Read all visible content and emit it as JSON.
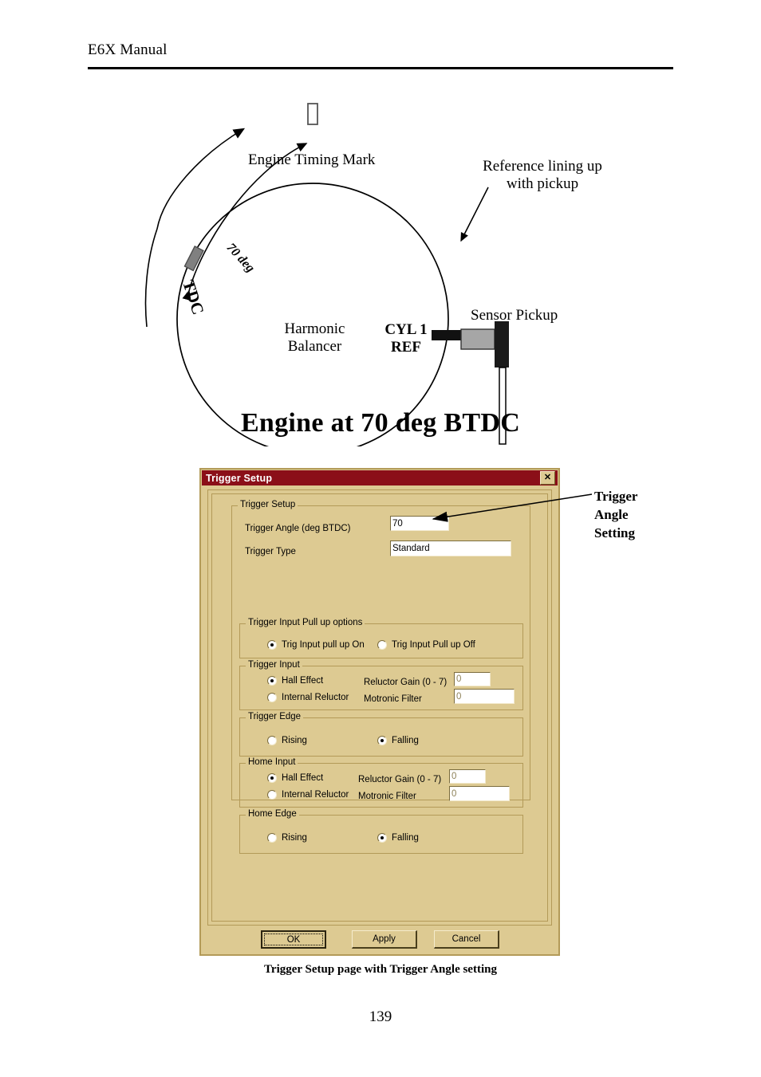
{
  "page": {
    "header": "E6X Manual",
    "folio": "139",
    "caption": "Trigger Setup page with Trigger Angle setting"
  },
  "diagram": {
    "heading": "Engine at 70 deg BTDC",
    "timing_mark_label": "Engine Timing Mark",
    "reference_label": "Reference lining up\nwith pickup",
    "sensor_label": "Sensor Pickup",
    "balancer_label": "Harmonic\nBalancer",
    "cyl1_ref_label": "CYL 1\nREF",
    "tdc_label": "TDC",
    "angle_label": "70 deg",
    "colors": {
      "tdc_mark": "#808080",
      "sensor_body": "#a6a6a6",
      "sensor_tip": "#1a1a1a",
      "outline": "#000000"
    }
  },
  "callout": {
    "label": "Trigger\nAngle\nSetting"
  },
  "dialog": {
    "title": "Trigger Setup",
    "close_label": "✕",
    "colors": {
      "titlebar": "#8b0f18",
      "face": "#ddca92",
      "border": "#b39a58"
    },
    "groups": {
      "trigger_setup": {
        "title": "Trigger Setup",
        "angle_label": "Trigger Angle (deg BTDC)",
        "angle_value": "70",
        "type_label": "Trigger Type",
        "type_value": "Standard"
      },
      "pullup": {
        "title": "Trigger Input Pull up options",
        "options": [
          {
            "label": "Trig Input pull up On",
            "selected": true
          },
          {
            "label": "Trig Input Pull up Off",
            "selected": false
          }
        ]
      },
      "trigger_input": {
        "title": "Trigger Input",
        "options": [
          {
            "label": "Hall Effect",
            "selected": true
          },
          {
            "label": "Internal Reluctor",
            "selected": false
          }
        ],
        "gain_label": "Reluctor Gain (0 - 7)",
        "gain_value": "0",
        "filter_label": "Motronic Filter",
        "filter_value": "0"
      },
      "trigger_edge": {
        "title": "Trigger Edge",
        "options": [
          {
            "label": "Rising",
            "selected": false
          },
          {
            "label": "Falling",
            "selected": true
          }
        ]
      },
      "home_input": {
        "title": "Home Input",
        "options": [
          {
            "label": "Hall Effect",
            "selected": true
          },
          {
            "label": "Internal Reluctor",
            "selected": false
          }
        ],
        "gain_label": "Reluctor Gain (0 - 7)",
        "gain_value": "0",
        "filter_label": "Motronic Filter",
        "filter_value": "0"
      },
      "home_edge": {
        "title": "Home Edge",
        "options": [
          {
            "label": "Rising",
            "selected": false
          },
          {
            "label": "Falling",
            "selected": true
          }
        ]
      }
    },
    "buttons": {
      "ok": "OK",
      "apply": "Apply",
      "cancel": "Cancel"
    }
  }
}
